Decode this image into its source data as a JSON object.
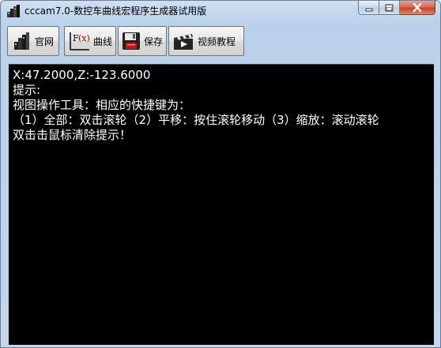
{
  "window": {
    "title": "cccam7.0-数控车曲线宏程序生成器试用版"
  },
  "toolbar": {
    "buttons": [
      {
        "label": "官网",
        "icon": "house-icon"
      },
      {
        "label": "曲线",
        "icon": "function-curve-icon"
      },
      {
        "label": "保存",
        "icon": "floppy-disk-icon"
      },
      {
        "label": "视频教程",
        "icon": "clapperboard-icon"
      }
    ]
  },
  "viewport": {
    "coords": "X:47.2000,Z:-123.6000",
    "hint_title": "提示:",
    "line1": "视图操作工具：相应的快捷键为：",
    "line2": "（1）全部：双击滚轮（2）平移：按住滚轮移动（3）缩放：滚动滚轮",
    "line3": "双击击鼠标清除提示！"
  },
  "colors": {
    "viewport_bg": "#000000",
    "viewport_text": "#ffffff",
    "close_button": "#c6432b"
  }
}
